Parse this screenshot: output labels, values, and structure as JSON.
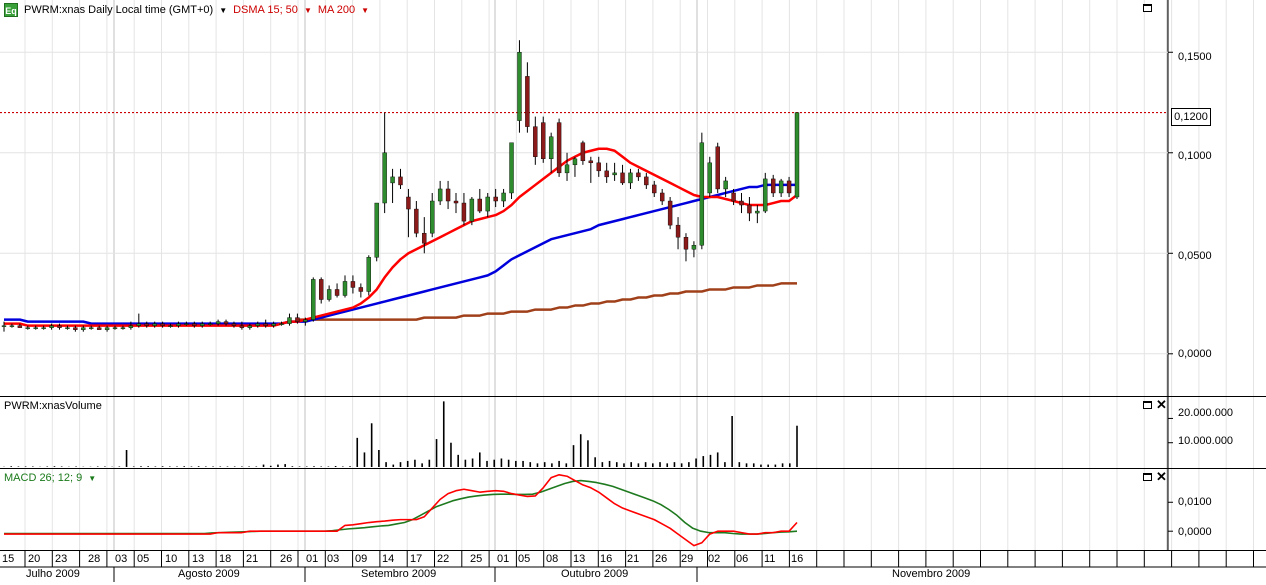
{
  "header": {
    "logo_text": "Eq",
    "symbol": "PWRM:xnas Daily Local time (GMT+0)",
    "indicator1": "DSMA 15; 50",
    "indicator2": "MA 200"
  },
  "price_pane": {
    "y_ticks": [
      "0,1500",
      "0,1000",
      "0,0500",
      "0,0000"
    ],
    "current_price_label": "0,1200",
    "colors": {
      "dsma15": "#ff0000",
      "dsma50": "#0000dd",
      "ma200": "#a0401a",
      "up": "#2e8b2e",
      "down": "#8b1a1a",
      "price_line": "#cc0000"
    }
  },
  "volume_pane": {
    "title": "PWRM:xnasVolume",
    "y_ticks": [
      "20.000.000",
      "10.000.000"
    ]
  },
  "macd_pane": {
    "title": "MACD 26; 12; 9",
    "y_ticks": [
      "0,0100",
      "0,0000"
    ]
  },
  "x_axis": {
    "day_labels": [
      "15",
      "20",
      "23",
      "28",
      "03",
      "05",
      "10",
      "13",
      "18",
      "21",
      "26",
      "01",
      "03",
      "09",
      "14",
      "17",
      "22",
      "25",
      "01",
      "05",
      "08",
      "13",
      "16",
      "21",
      "26",
      "29",
      "02",
      "06",
      "11",
      "16"
    ],
    "month_labels": [
      "Julho 2009",
      "Agosto 2009",
      "Setembro 2009",
      "Outubro 2009",
      "Novembro 2009"
    ]
  },
  "chart_data": {
    "type": "candlestick",
    "title": "PWRM:xnas Daily Local time (GMT+0)",
    "ylim": [
      -0.02,
      0.175
    ],
    "current_price": 0.12,
    "candles": [
      [
        0.014,
        0.016,
        0.011,
        0.014
      ],
      [
        0.014,
        0.015,
        0.013,
        0.014
      ],
      [
        0.014,
        0.015,
        0.013,
        0.013
      ],
      [
        0.013,
        0.014,
        0.012,
        0.013
      ],
      [
        0.013,
        0.014,
        0.012,
        0.013
      ],
      [
        0.013,
        0.014,
        0.012,
        0.013
      ],
      [
        0.013,
        0.015,
        0.012,
        0.014
      ],
      [
        0.014,
        0.015,
        0.012,
        0.013
      ],
      [
        0.013,
        0.014,
        0.012,
        0.013
      ],
      [
        0.013,
        0.014,
        0.011,
        0.012
      ],
      [
        0.012,
        0.014,
        0.011,
        0.013
      ],
      [
        0.013,
        0.014,
        0.012,
        0.013
      ],
      [
        0.013,
        0.014,
        0.012,
        0.012
      ],
      [
        0.012,
        0.014,
        0.011,
        0.013
      ],
      [
        0.013,
        0.014,
        0.012,
        0.013
      ],
      [
        0.013,
        0.014,
        0.012,
        0.013
      ],
      [
        0.013,
        0.016,
        0.012,
        0.014
      ],
      [
        0.014,
        0.02,
        0.013,
        0.015
      ],
      [
        0.015,
        0.016,
        0.013,
        0.014
      ],
      [
        0.014,
        0.016,
        0.013,
        0.015
      ],
      [
        0.015,
        0.016,
        0.013,
        0.014
      ],
      [
        0.014,
        0.015,
        0.013,
        0.014
      ],
      [
        0.014,
        0.016,
        0.013,
        0.015
      ],
      [
        0.015,
        0.016,
        0.014,
        0.015
      ],
      [
        0.015,
        0.016,
        0.013,
        0.014
      ],
      [
        0.014,
        0.016,
        0.013,
        0.015
      ],
      [
        0.015,
        0.016,
        0.014,
        0.015
      ],
      [
        0.015,
        0.017,
        0.014,
        0.016
      ],
      [
        0.016,
        0.017,
        0.014,
        0.015
      ],
      [
        0.015,
        0.016,
        0.013,
        0.014
      ],
      [
        0.014,
        0.016,
        0.012,
        0.013
      ],
      [
        0.013,
        0.015,
        0.012,
        0.014
      ],
      [
        0.014,
        0.016,
        0.013,
        0.015
      ],
      [
        0.015,
        0.017,
        0.013,
        0.014
      ],
      [
        0.014,
        0.016,
        0.013,
        0.015
      ],
      [
        0.015,
        0.016,
        0.014,
        0.015
      ],
      [
        0.015,
        0.02,
        0.014,
        0.018
      ],
      [
        0.018,
        0.02,
        0.015,
        0.016
      ],
      [
        0.016,
        0.018,
        0.014,
        0.017
      ],
      [
        0.017,
        0.038,
        0.016,
        0.037
      ],
      [
        0.037,
        0.038,
        0.025,
        0.027
      ],
      [
        0.027,
        0.034,
        0.026,
        0.032
      ],
      [
        0.032,
        0.035,
        0.028,
        0.029
      ],
      [
        0.029,
        0.039,
        0.028,
        0.036
      ],
      [
        0.036,
        0.039,
        0.03,
        0.033
      ],
      [
        0.033,
        0.035,
        0.028,
        0.031
      ],
      [
        0.031,
        0.049,
        0.029,
        0.048
      ],
      [
        0.048,
        0.06,
        0.046,
        0.075
      ],
      [
        0.075,
        0.12,
        0.07,
        0.1
      ],
      [
        0.085,
        0.092,
        0.075,
        0.088
      ],
      [
        0.088,
        0.092,
        0.082,
        0.084
      ],
      [
        0.078,
        0.082,
        0.058,
        0.072
      ],
      [
        0.072,
        0.076,
        0.058,
        0.06
      ],
      [
        0.06,
        0.068,
        0.05,
        0.055
      ],
      [
        0.06,
        0.08,
        0.058,
        0.076
      ],
      [
        0.076,
        0.086,
        0.074,
        0.082
      ],
      [
        0.082,
        0.086,
        0.072,
        0.076
      ],
      [
        0.076,
        0.08,
        0.07,
        0.075
      ],
      [
        0.075,
        0.08,
        0.064,
        0.066
      ],
      [
        0.066,
        0.078,
        0.064,
        0.077
      ],
      [
        0.077,
        0.082,
        0.07,
        0.071
      ],
      [
        0.071,
        0.08,
        0.068,
        0.078
      ],
      [
        0.078,
        0.082,
        0.073,
        0.076
      ],
      [
        0.076,
        0.082,
        0.073,
        0.08
      ],
      [
        0.08,
        0.1,
        0.077,
        0.105
      ],
      [
        0.116,
        0.156,
        0.11,
        0.15
      ],
      [
        0.138,
        0.145,
        0.11,
        0.113
      ],
      [
        0.113,
        0.118,
        0.094,
        0.098
      ],
      [
        0.115,
        0.118,
        0.095,
        0.097
      ],
      [
        0.097,
        0.11,
        0.09,
        0.108
      ],
      [
        0.115,
        0.117,
        0.088,
        0.09
      ],
      [
        0.09,
        0.1,
        0.086,
        0.094
      ],
      [
        0.094,
        0.098,
        0.088,
        0.097
      ],
      [
        0.105,
        0.106,
        0.094,
        0.096
      ],
      [
        0.096,
        0.098,
        0.085,
        0.095
      ],
      [
        0.095,
        0.098,
        0.088,
        0.091
      ],
      [
        0.091,
        0.095,
        0.085,
        0.088
      ],
      [
        0.089,
        0.095,
        0.086,
        0.09
      ],
      [
        0.09,
        0.094,
        0.084,
        0.085
      ],
      [
        0.085,
        0.092,
        0.082,
        0.09
      ],
      [
        0.09,
        0.092,
        0.086,
        0.088
      ],
      [
        0.088,
        0.09,
        0.082,
        0.084
      ],
      [
        0.084,
        0.086,
        0.078,
        0.08
      ],
      [
        0.08,
        0.082,
        0.074,
        0.076
      ],
      [
        0.076,
        0.078,
        0.062,
        0.064
      ],
      [
        0.064,
        0.068,
        0.052,
        0.058
      ],
      [
        0.058,
        0.06,
        0.046,
        0.052
      ],
      [
        0.052,
        0.056,
        0.048,
        0.054
      ],
      [
        0.054,
        0.11,
        0.052,
        0.105
      ],
      [
        0.08,
        0.098,
        0.078,
        0.095
      ],
      [
        0.103,
        0.105,
        0.08,
        0.082
      ],
      [
        0.082,
        0.088,
        0.078,
        0.086
      ],
      [
        0.08,
        0.082,
        0.074,
        0.076
      ],
      [
        0.076,
        0.08,
        0.07,
        0.074
      ],
      [
        0.074,
        0.078,
        0.066,
        0.07
      ],
      [
        0.07,
        0.074,
        0.065,
        0.071
      ],
      [
        0.071,
        0.09,
        0.07,
        0.087
      ],
      [
        0.087,
        0.089,
        0.078,
        0.08
      ],
      [
        0.08,
        0.087,
        0.078,
        0.086
      ],
      [
        0.086,
        0.088,
        0.078,
        0.08
      ],
      [
        0.078,
        0.12,
        0.077,
        0.12
      ]
    ],
    "dsma15": [
      0.015,
      0.015,
      0.015,
      0.014,
      0.014,
      0.014,
      0.014,
      0.014,
      0.014,
      0.014,
      0.014,
      0.014,
      0.014,
      0.014,
      0.014,
      0.014,
      0.014,
      0.014,
      0.014,
      0.014,
      0.014,
      0.014,
      0.014,
      0.014,
      0.014,
      0.014,
      0.014,
      0.014,
      0.014,
      0.014,
      0.014,
      0.014,
      0.014,
      0.014,
      0.014,
      0.015,
      0.016,
      0.016,
      0.017,
      0.018,
      0.019,
      0.02,
      0.021,
      0.022,
      0.023,
      0.025,
      0.028,
      0.032,
      0.038,
      0.043,
      0.047,
      0.05,
      0.052,
      0.054,
      0.056,
      0.058,
      0.06,
      0.062,
      0.064,
      0.066,
      0.067,
      0.068,
      0.069,
      0.071,
      0.074,
      0.078,
      0.081,
      0.084,
      0.087,
      0.09,
      0.093,
      0.096,
      0.098,
      0.1,
      0.101,
      0.102,
      0.102,
      0.101,
      0.098,
      0.095,
      0.093,
      0.091,
      0.089,
      0.087,
      0.085,
      0.083,
      0.081,
      0.079,
      0.078,
      0.078,
      0.078,
      0.077,
      0.076,
      0.075,
      0.074,
      0.074,
      0.074,
      0.075,
      0.076,
      0.076,
      0.079
    ],
    "dsma50": [
      0.017,
      0.017,
      0.017,
      0.016,
      0.016,
      0.016,
      0.016,
      0.016,
      0.016,
      0.016,
      0.016,
      0.015,
      0.015,
      0.015,
      0.015,
      0.015,
      0.015,
      0.015,
      0.015,
      0.015,
      0.015,
      0.015,
      0.015,
      0.015,
      0.015,
      0.015,
      0.015,
      0.015,
      0.015,
      0.015,
      0.015,
      0.015,
      0.015,
      0.015,
      0.015,
      0.015,
      0.016,
      0.016,
      0.016,
      0.017,
      0.018,
      0.019,
      0.02,
      0.021,
      0.022,
      0.023,
      0.024,
      0.025,
      0.026,
      0.027,
      0.028,
      0.029,
      0.03,
      0.031,
      0.032,
      0.033,
      0.034,
      0.035,
      0.036,
      0.037,
      0.038,
      0.039,
      0.041,
      0.044,
      0.047,
      0.049,
      0.051,
      0.053,
      0.055,
      0.057,
      0.058,
      0.059,
      0.06,
      0.061,
      0.062,
      0.064,
      0.065,
      0.066,
      0.067,
      0.068,
      0.069,
      0.07,
      0.071,
      0.072,
      0.073,
      0.074,
      0.075,
      0.076,
      0.077,
      0.078,
      0.079,
      0.08,
      0.081,
      0.082,
      0.083,
      0.083,
      0.084,
      0.084,
      0.084,
      0.084,
      0.084
    ],
    "ma200": [
      0.017,
      0.017,
      0.017,
      0.017,
      0.017,
      0.017,
      0.017,
      0.017,
      0.017,
      0.017,
      0.017,
      0.017,
      0.017,
      0.017,
      0.017,
      0.017,
      0.018,
      0.018,
      0.018,
      0.018,
      0.018,
      0.019,
      0.019,
      0.019,
      0.02,
      0.02,
      0.02,
      0.021,
      0.021,
      0.021,
      0.022,
      0.022,
      0.022,
      0.023,
      0.023,
      0.024,
      0.024,
      0.025,
      0.025,
      0.026,
      0.026,
      0.027,
      0.027,
      0.028,
      0.028,
      0.029,
      0.029,
      0.03,
      0.03,
      0.031,
      0.031,
      0.031,
      0.032,
      0.032,
      0.032,
      0.033,
      0.033,
      0.033,
      0.034,
      0.034,
      0.034,
      0.035,
      0.035,
      0.035
    ],
    "ma200_start_index": 37,
    "volume": [
      0.1,
      0.3,
      0.2,
      0.2,
      0.2,
      0.1,
      0.2,
      0.3,
      0.2,
      0.1,
      0.2,
      0.1,
      0.1,
      0.2,
      0.2,
      0.1,
      0.2,
      7.0,
      0.2,
      0.3,
      0.3,
      0.2,
      0.3,
      0.2,
      0.2,
      0.3,
      0.2,
      0.3,
      0.2,
      0.2,
      0.2,
      0.2,
      0.2,
      0.2,
      0.2,
      0.2,
      1.0,
      0.5,
      1.0,
      1.2,
      0.3,
      0.2,
      0.2,
      0.3,
      0.2,
      0.2,
      0.4,
      0.2,
      0.3,
      12.0,
      6.0,
      18.0,
      7.0,
      2.0,
      1.0,
      2.0,
      2.5,
      3.0,
      1.5,
      3.0,
      11.5,
      27.0,
      10.0,
      5.0,
      3.0,
      3.5,
      6.0,
      2.5,
      3.0,
      3.5,
      3.0,
      2.5,
      2.5,
      2.0,
      1.5,
      2.0,
      1.5,
      2.5,
      1.5,
      9.0,
      13.5,
      11.0,
      4.0,
      2.0,
      2.5,
      2.0,
      1.5,
      2.0,
      1.5,
      2.0,
      1.5,
      2.0,
      1.5,
      2.0,
      1.5,
      2.0,
      3.5,
      4.5,
      5.0,
      6.0,
      2.0,
      21.0,
      2.0,
      1.5,
      1.5,
      1.0,
      1.0,
      1.0,
      1.5,
      1.5,
      17.0
    ],
    "macd_line": [
      -0.001,
      -0.001,
      -0.001,
      -0.001,
      -0.001,
      -0.001,
      -0.001,
      -0.001,
      -0.001,
      -0.001,
      -0.001,
      -0.001,
      -0.001,
      -0.001,
      -0.001,
      -0.001,
      -0.001,
      -0.001,
      -0.001,
      -0.001,
      -0.001,
      -0.001,
      -0.001,
      -0.001,
      -0.001,
      -0.001,
      -0.001,
      -0.0005,
      -0.0005,
      -0.0005,
      -0.0005,
      0.0,
      0.0,
      0.0,
      0.0,
      0.0,
      0.0,
      0.0,
      0.0,
      0.0,
      0.0,
      0.0,
      0.0,
      0.002,
      0.0022,
      0.0026,
      0.003,
      0.0033,
      0.0035,
      0.0038,
      0.004,
      0.004,
      0.004,
      0.005,
      0.008,
      0.011,
      0.013,
      0.014,
      0.0145,
      0.014,
      0.0135,
      0.0138,
      0.014,
      0.0138,
      0.013,
      0.0125,
      0.012,
      0.0122,
      0.015,
      0.0185,
      0.0195,
      0.019,
      0.0175,
      0.016,
      0.015,
      0.0135,
      0.0115,
      0.0095,
      0.008,
      0.007,
      0.006,
      0.005,
      0.004,
      0.0025,
      0.001,
      -0.001,
      -0.003,
      -0.005,
      -0.004,
      -0.001,
      0.0,
      0.0,
      0.0,
      -0.0005,
      -0.001,
      -0.001,
      -0.0005,
      -0.0005,
      0.0,
      0.0,
      0.003
    ],
    "macd_signal": [
      -0.0008,
      -0.0008,
      -0.0008,
      -0.0008,
      -0.0008,
      -0.0008,
      -0.0008,
      -0.0008,
      -0.0008,
      -0.0008,
      -0.0008,
      -0.0008,
      -0.0008,
      -0.0008,
      -0.0008,
      -0.0008,
      -0.0008,
      -0.0008,
      -0.0008,
      -0.0008,
      -0.0008,
      -0.0008,
      -0.0008,
      -0.0008,
      -0.0008,
      -0.0008,
      -0.0006,
      -0.0005,
      -0.0004,
      -0.0003,
      -0.0002,
      -0.0001,
      0.0,
      0.0,
      0.0,
      0.0,
      0.0,
      0.0,
      0.0,
      0.0,
      0.0,
      0.0002,
      0.0005,
      0.0008,
      0.001,
      0.0012,
      0.0015,
      0.0018,
      0.002,
      0.0025,
      0.003,
      0.004,
      0.0055,
      0.007,
      0.0085,
      0.0095,
      0.0105,
      0.0112,
      0.0118,
      0.0122,
      0.0125,
      0.0127,
      0.0128,
      0.0128,
      0.0127,
      0.0127,
      0.0128,
      0.0135,
      0.0145,
      0.0155,
      0.0165,
      0.0172,
      0.0175,
      0.0172,
      0.0168,
      0.0162,
      0.0155,
      0.0145,
      0.0135,
      0.0125,
      0.0115,
      0.0105,
      0.0092,
      0.0075,
      0.0055,
      0.003,
      0.001,
      0.0,
      -0.0005,
      -0.0005,
      -0.0005,
      -0.0008,
      -0.001,
      -0.001,
      -0.001,
      -0.0008,
      -0.0005,
      -0.0003,
      -0.0002,
      0.0
    ],
    "macd_ylim": [
      -0.0065,
      0.0215
    ],
    "volume_ylim_millions": [
      0,
      28
    ]
  }
}
